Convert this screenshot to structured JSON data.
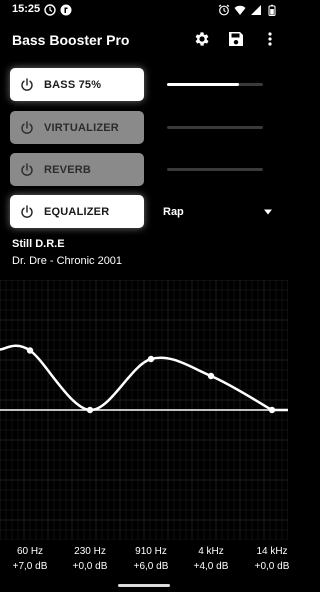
{
  "status_bar": {
    "time": "15:25"
  },
  "app_bar": {
    "title": "Bass Booster Pro"
  },
  "effects": {
    "bass": {
      "label": "BASS 75%",
      "enabled": true,
      "level": 0.75
    },
    "virtualizer": {
      "label": "VIRTUALIZER",
      "enabled": false,
      "level": 0.0
    },
    "reverb": {
      "label": "REVERB",
      "enabled": false,
      "level": 0.0
    },
    "equalizer": {
      "label": "EQUALIZER",
      "enabled": true,
      "preset": "Rap"
    }
  },
  "track": {
    "title": "Still D.R.E",
    "artist_album": "Dr. Dre - Chronic 2001"
  },
  "eq": {
    "min_db": -12,
    "max_db": 12,
    "bands": [
      {
        "freq": "60 Hz",
        "gain": "+7,0 dB",
        "gain_db": 7.0
      },
      {
        "freq": "230 Hz",
        "gain": "+0,0 dB",
        "gain_db": 0.0
      },
      {
        "freq": "910 Hz",
        "gain": "+6,0 dB",
        "gain_db": 6.0
      },
      {
        "freq": "4 kHz",
        "gain": "+4,0 dB",
        "gain_db": 4.0
      },
      {
        "freq": "14 kHz",
        "gain": "+0,0 dB",
        "gain_db": 0.0
      }
    ]
  },
  "colors": {
    "background": "#000000",
    "active_button": "#ffffff",
    "inactive_button": "#8a8a8a",
    "accent": "#ffffff"
  },
  "icons": [
    "notification-icon",
    "clock-icon",
    "alarm-icon",
    "wifi-icon",
    "signal-icon",
    "battery-icon",
    "settings-gear-icon",
    "save-icon",
    "overflow-menu-icon",
    "power-icon",
    "dropdown-arrow-icon"
  ]
}
